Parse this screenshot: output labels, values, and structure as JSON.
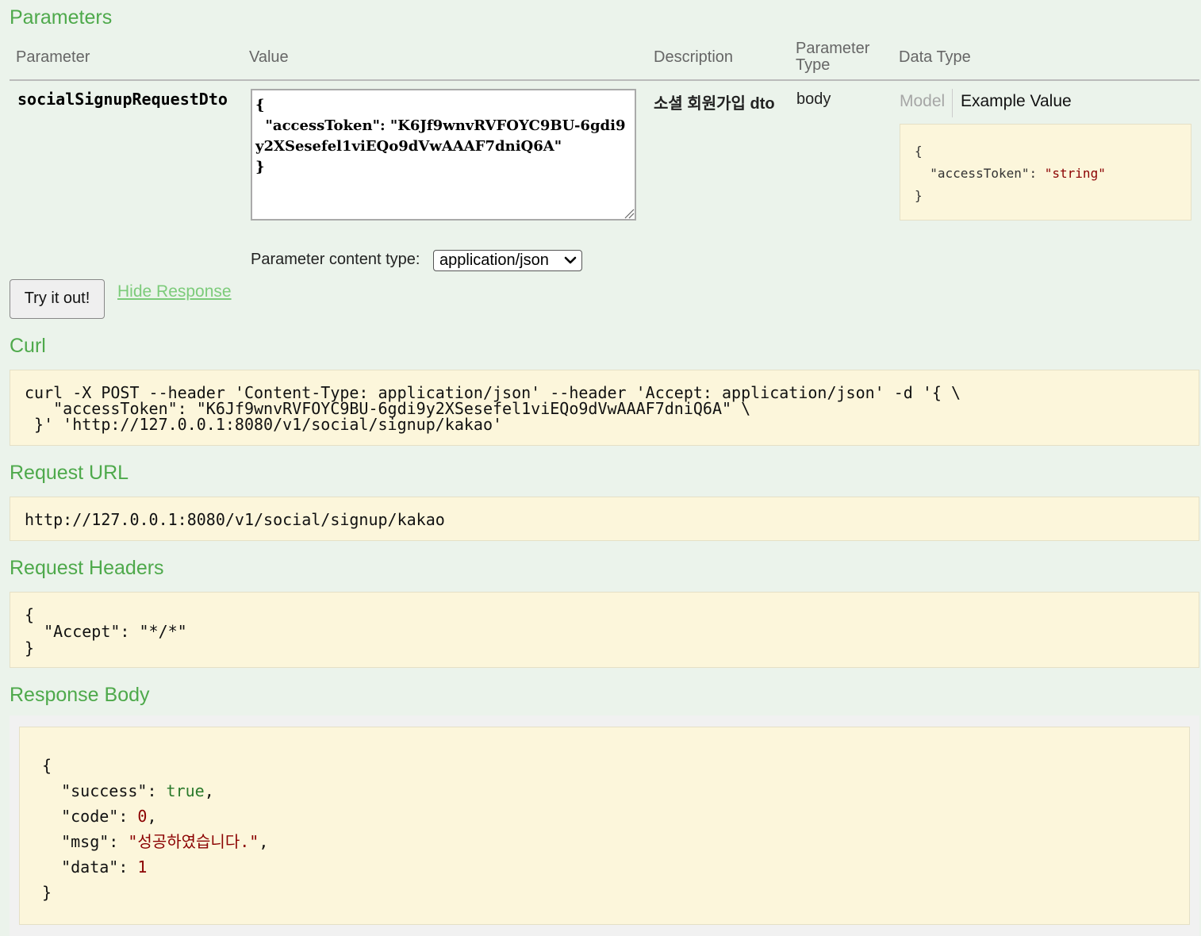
{
  "parameters": {
    "heading": "Parameters",
    "columns": {
      "parameter": "Parameter",
      "value": "Value",
      "description": "Description",
      "parameter_type_line1": "Parameter",
      "parameter_type_line2": "Type",
      "data_type": "Data Type"
    },
    "row": {
      "name": "socialSignupRequestDto",
      "value": "{\n  \"accessToken\": \"K6Jf9wnvRVFOYC9BU-6gdi9y2XSesefel1viEQo9dVwAAAF7dniQ6A\"\n}",
      "description": "소셜 회원가입 dto",
      "parameter_type": "body",
      "data_type_tabs": {
        "model": "Model",
        "example": "Example Value"
      },
      "example_value": {
        "open": "{",
        "key": "  \"accessToken\": ",
        "val": "\"string\"",
        "close": "}"
      }
    },
    "content_type_label": "Parameter content type:",
    "content_type_selected": "application/json"
  },
  "actions": {
    "try_button": "Try it out!",
    "hide_link": "Hide Response"
  },
  "curl": {
    "heading": "Curl",
    "command": "curl -X POST --header 'Content-Type: application/json' --header 'Accept: application/json' -d '{ \\\n   \"accessToken\": \"K6Jf9wnvRVFOYC9BU-6gdi9y2XSesefel1viEQo9dVwAAAF7dniQ6A\" \\\n }' 'http://127.0.0.1:8080/v1/social/signup/kakao'"
  },
  "request_url": {
    "heading": "Request URL",
    "url": "http://127.0.0.1:8080/v1/social/signup/kakao"
  },
  "request_headers": {
    "heading": "Request Headers",
    "body": "{\n  \"Accept\": \"*/*\"\n}"
  },
  "response_body": {
    "heading": "Response Body",
    "open": "{",
    "success_key": "  \"success\": ",
    "success_val": "true",
    "code_key": "  \"code\": ",
    "code_val": "0",
    "msg_key": "  \"msg\": ",
    "msg_val": "\"성공하였습니다.\"",
    "data_key": "  \"data\": ",
    "data_val": "1",
    "comma": ",",
    "close": "}"
  },
  "colors": {
    "background": "#ebf3eb",
    "heading_green": "#4ea94b",
    "code_background": "#fcf6db",
    "string_red": "#8b0000",
    "boolean_green": "#2b7a2b"
  }
}
